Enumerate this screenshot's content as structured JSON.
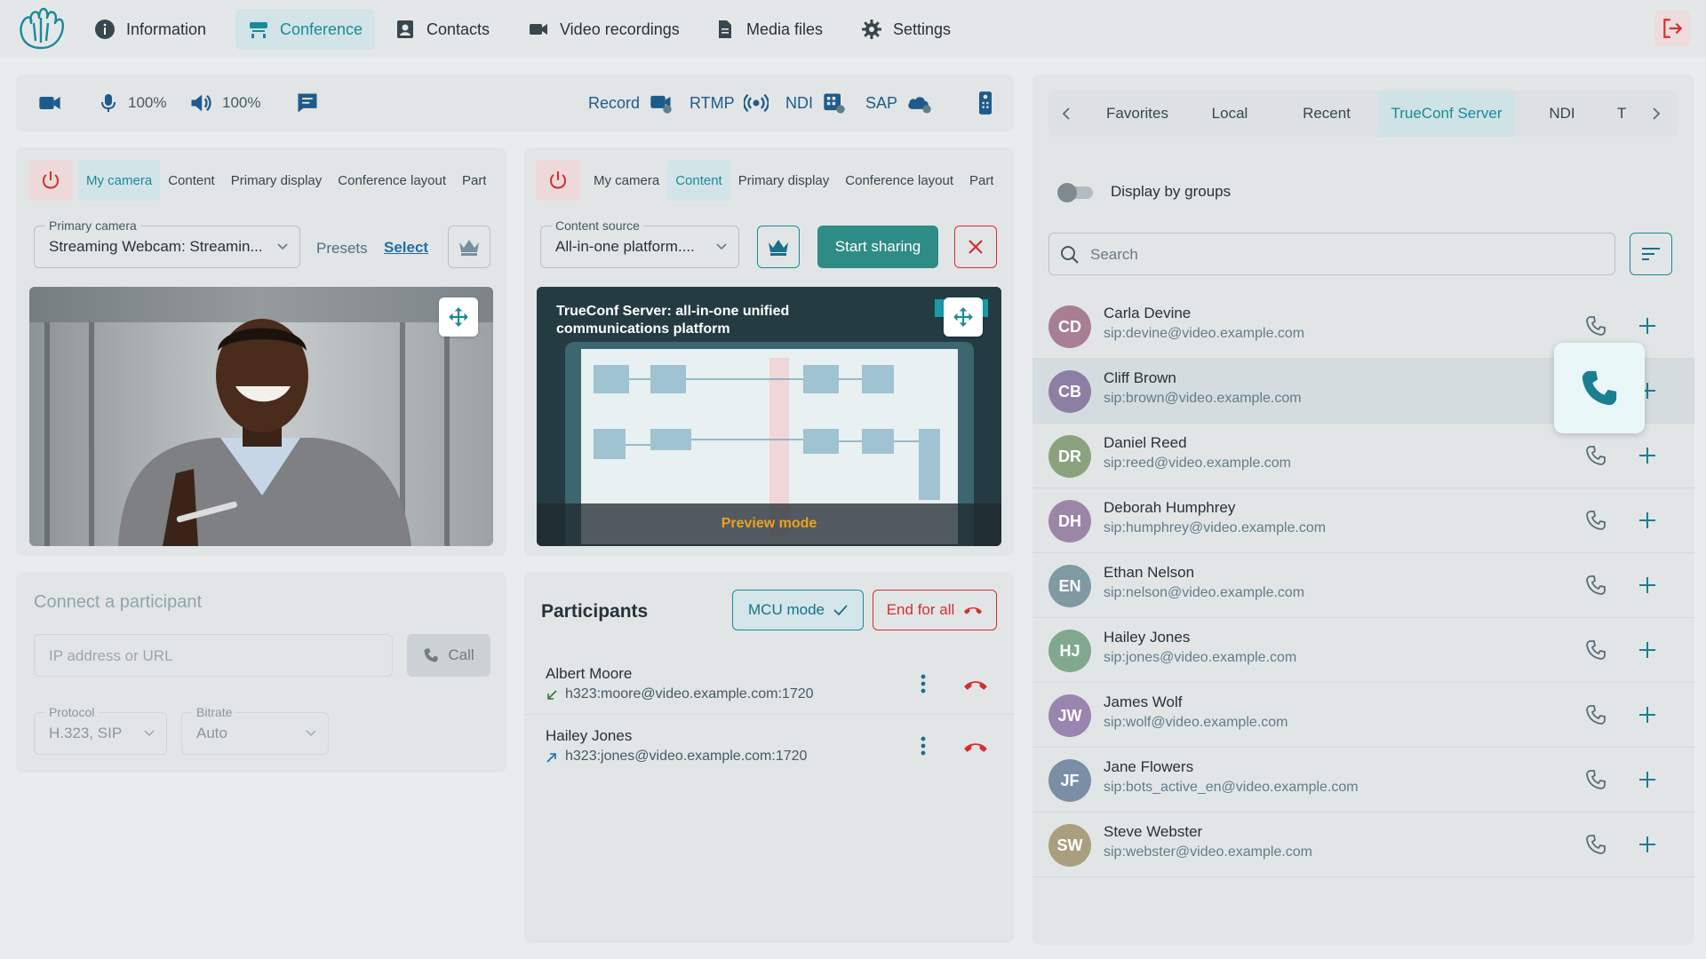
{
  "nav": {
    "items": [
      {
        "label": "Information",
        "icon": "info-icon"
      },
      {
        "label": "Conference",
        "icon": "conference-icon"
      },
      {
        "label": "Contacts",
        "icon": "contacts-icon"
      },
      {
        "label": "Video recordings",
        "icon": "video-recordings-icon"
      },
      {
        "label": "Media files",
        "icon": "media-files-icon"
      },
      {
        "label": "Settings",
        "icon": "gear-icon"
      }
    ],
    "active": "Conference"
  },
  "toolbar": {
    "mic_level": "100%",
    "speaker_level": "100%",
    "record_label": "Record",
    "rtmp_label": "RTMP",
    "ndi_label": "NDI",
    "sap_label": "SAP"
  },
  "left_source": {
    "tabs": [
      "My camera",
      "Content",
      "Primary display",
      "Conference layout",
      "Parti"
    ],
    "active_tab": "My camera",
    "camera_label": "Primary camera",
    "camera_value": "Streaming Webcam: Streamin...",
    "presets_label": "Presets",
    "select_label": "Select"
  },
  "right_source": {
    "tabs": [
      "My camera",
      "Content",
      "Primary display",
      "Conference layout",
      "Parti"
    ],
    "active_tab": "Content",
    "content_label": "Content source",
    "content_value": "All-in-one platform....",
    "start_sharing": "Start sharing",
    "slide_title_1": "TrueConf Server: all-in-one unified",
    "slide_title_2": "communications platform",
    "preview_mode": "Preview mode"
  },
  "connect": {
    "title": "Connect a participant",
    "address_placeholder": "IP address or URL",
    "call_label": "Call",
    "protocol_label": "Protocol",
    "protocol_value": "H.323, SIP",
    "bitrate_label": "Bitrate",
    "bitrate_value": "Auto"
  },
  "participants": {
    "title": "Participants",
    "mcu_label": "MCU mode",
    "end_label": "End for all",
    "list": [
      {
        "name": "Albert Moore",
        "address": "h323:moore@video.example.com:1720",
        "direction": "incoming"
      },
      {
        "name": "Hailey Jones",
        "address": "h323:jones@video.example.com:1720",
        "direction": "outgoing"
      }
    ]
  },
  "contacts": {
    "tabs": [
      "Favorites",
      "Local",
      "Recent",
      "TrueConf Server",
      "NDI",
      "T"
    ],
    "active_tab": "TrueConf Server",
    "group_toggle_label": "Display by groups",
    "search_placeholder": "Search",
    "list": [
      {
        "initials": "CD",
        "name": "Carla Devine",
        "sip": "sip:devine@video.example.com",
        "color": "#a77f95"
      },
      {
        "initials": "CB",
        "name": "Cliff Brown",
        "sip": "sip:brown@video.example.com",
        "color": "#8d7fa4"
      },
      {
        "initials": "DR",
        "name": "Daniel Reed",
        "sip": "sip:reed@video.example.com",
        "color": "#8ba27f"
      },
      {
        "initials": "DH",
        "name": "Deborah Humphrey",
        "sip": "sip:humphrey@video.example.com",
        "color": "#9b86a8"
      },
      {
        "initials": "EN",
        "name": "Ethan Nelson",
        "sip": "sip:nelson@video.example.com",
        "color": "#7f9aa3"
      },
      {
        "initials": "HJ",
        "name": "Hailey Jones",
        "sip": "sip:jones@video.example.com",
        "color": "#7fa88e"
      },
      {
        "initials": "JW",
        "name": "James Wolf",
        "sip": "sip:wolf@video.example.com",
        "color": "#9a84b0"
      },
      {
        "initials": "JF",
        "name": "Jane Flowers",
        "sip": "sip:bots_active_en@video.example.com",
        "color": "#7a8ea6"
      },
      {
        "initials": "SW",
        "name": "Steve Webster",
        "sip": "sip:webster@video.example.com",
        "color": "#a99f7f"
      }
    ]
  },
  "colors": {
    "accent": "#1a8a9a",
    "danger": "#d32f2f",
    "primary_button": "#2e8b86"
  }
}
